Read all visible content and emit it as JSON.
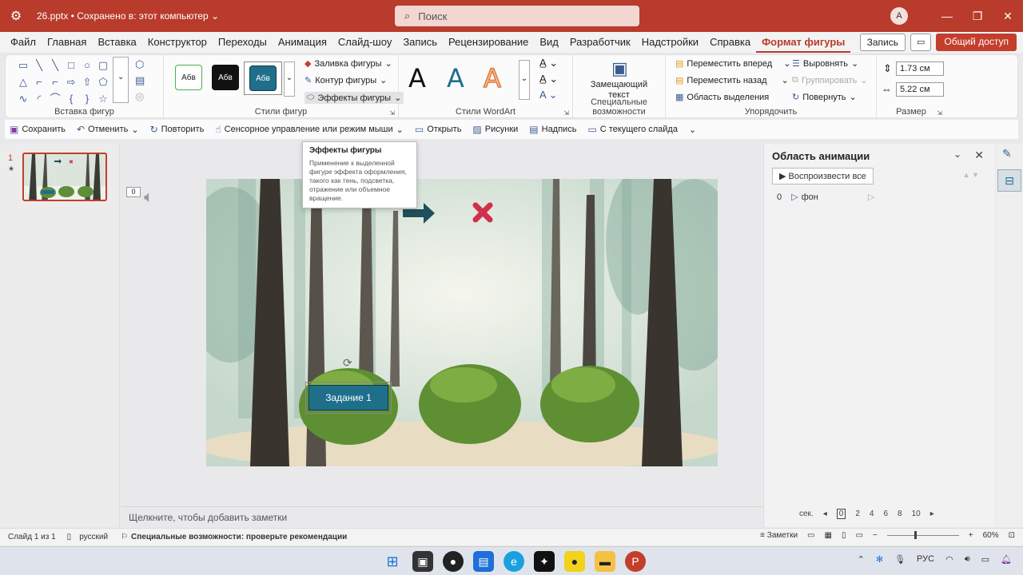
{
  "titlebar": {
    "title": "26.pptx • Сохранено в: этот компьютер ⌄",
    "search_placeholder": "Поиск",
    "avatar_letter": "A",
    "minimize": "—",
    "maximize": "❐",
    "close": "✕"
  },
  "tabs": [
    {
      "label": "Файл"
    },
    {
      "label": "Главная"
    },
    {
      "label": "Вставка"
    },
    {
      "label": "Конструктор"
    },
    {
      "label": "Переходы"
    },
    {
      "label": "Анимация"
    },
    {
      "label": "Слайд-шоу"
    },
    {
      "label": "Запись"
    },
    {
      "label": "Рецензирование"
    },
    {
      "label": "Вид"
    },
    {
      "label": "Разработчик"
    },
    {
      "label": "Надстройки"
    },
    {
      "label": "Справка"
    },
    {
      "label": "Формат фигуры"
    }
  ],
  "tabs_right": {
    "record": "Запись",
    "comment": "▭",
    "share": "Общий доступ"
  },
  "ribbon": {
    "insert_shapes_label": "Вставка фигур",
    "shape_styles_label": "Стили фигур",
    "style_sample": "Абв",
    "fill": "Заливка фигуры",
    "outline": "Контур фигуры",
    "effects": "Эффекты фигуры",
    "wordart_label": "Стили WordArt",
    "wordart_letter": "A",
    "accessibility_label": "Специальные возможности",
    "alt_text_line1": "Замещающий",
    "alt_text_line2": "текст",
    "arrange_label": "Упорядочить",
    "bring_forward": "Переместить вперед",
    "send_backward": "Переместить назад",
    "selection_pane": "Область выделения",
    "align": "Выровнять",
    "group": "Группировать",
    "rotate": "Повернуть",
    "size_label": "Размер",
    "height": "1.73 см",
    "width": "5.22 см"
  },
  "qat": {
    "save": "Сохранить",
    "undo": "Отменить",
    "redo": "Повторить",
    "touch": "Сенсорное управление или режим мыши",
    "open": "Открыть",
    "pictures": "Рисунки",
    "textbox": "Надпись",
    "from_current": "С текущего слайда"
  },
  "tooltip": {
    "title": "Эффекты фигуры",
    "text": "Применение к выделенной фигуре эффекта оформления, такого как тень, подсветка, отражение или объемное вращение."
  },
  "thumbs": {
    "number": "1",
    "star": "★"
  },
  "slide": {
    "anim_tag": "0",
    "task_label": "Задание 1"
  },
  "notes": {
    "placeholder": "Щелкните, чтобы добавить заметки"
  },
  "animpane": {
    "title": "Область анимации",
    "play_all": "Воспроизвести все",
    "item_index": "0",
    "item_name": "фон",
    "unit": "сек.",
    "ticks": [
      "0",
      "2",
      "4",
      "6",
      "8",
      "10"
    ]
  },
  "status": {
    "slide_of": "Слайд 1 из 1",
    "language": "русский",
    "accessibility": "Специальные возможности: проверьте рекомендации",
    "notes": "Заметки",
    "zoom": "60%"
  },
  "taskbar": {
    "lang": "РУС"
  }
}
